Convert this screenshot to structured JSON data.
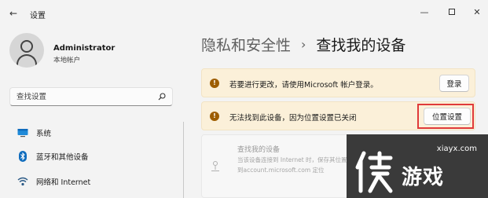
{
  "window": {
    "title": "设置",
    "back_glyph": "←",
    "minimize_glyph": "—",
    "close_glyph": "✕"
  },
  "profile": {
    "name": "Administrator",
    "account_type": "本地帐户"
  },
  "search": {
    "placeholder": "查找设置"
  },
  "nav": {
    "items": [
      {
        "label": "系统",
        "icon": "monitor-icon"
      },
      {
        "label": "蓝牙和其他设备",
        "icon": "bluetooth-icon"
      },
      {
        "label": "网络和 Internet",
        "icon": "network-icon"
      }
    ]
  },
  "breadcrumb": {
    "parent": "隐私和安全性",
    "separator": "›",
    "current": "查找我的设备"
  },
  "cards": {
    "login": {
      "icon_glyph": "!",
      "text": "若要进行更改，请使用Microsoft 帐户登录。",
      "button": "登录"
    },
    "location_off": {
      "icon_glyph": "!",
      "text": "无法找到此设备，因为位置设置已关闭",
      "button": "位置设置"
    },
    "find_device": {
      "title": "查找我的设备",
      "description": "当该设备连接到 Internet 时，保存其位置，转到account.microsoft.com 定位"
    }
  },
  "watermark": {
    "url": "xiayx.com",
    "text": "游戏"
  },
  "colors": {
    "warning_bg": "#fbf0d9",
    "warning_icon": "#9d5d00",
    "highlight": "#e03a3a",
    "window_bg": "#f3f3f3"
  }
}
